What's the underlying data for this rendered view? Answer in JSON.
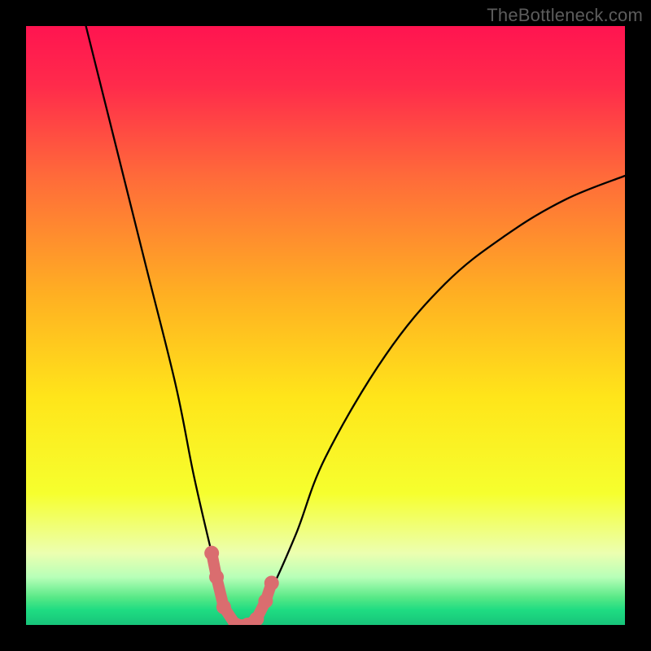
{
  "watermark": "TheBottleneck.com",
  "chart_data": {
    "type": "line",
    "title": "",
    "xlabel": "",
    "ylabel": "",
    "x_range": [
      0,
      100
    ],
    "y_range": [
      0,
      100
    ],
    "series": [
      {
        "name": "bottleneck-curve",
        "x": [
          10,
          15,
          20,
          25,
          28,
          31,
          33,
          35,
          37,
          40,
          45,
          50,
          60,
          70,
          80,
          90,
          100
        ],
        "y": [
          100,
          80,
          60,
          40,
          25,
          12,
          4,
          0,
          0,
          4,
          15,
          28,
          45,
          57,
          65,
          71,
          75
        ]
      }
    ],
    "markers": {
      "name": "highlight-cluster",
      "color": "#da6d6f",
      "points": [
        {
          "x": 31.0,
          "y": 12
        },
        {
          "x": 31.8,
          "y": 8
        },
        {
          "x": 33.0,
          "y": 3
        },
        {
          "x": 35.0,
          "y": 0
        },
        {
          "x": 37.0,
          "y": 0
        },
        {
          "x": 38.5,
          "y": 1
        },
        {
          "x": 40.0,
          "y": 4
        },
        {
          "x": 41.0,
          "y": 7
        }
      ]
    },
    "gradient_stops": [
      {
        "pos": 0.0,
        "color": "#ff1450"
      },
      {
        "pos": 0.1,
        "color": "#ff2b4b"
      },
      {
        "pos": 0.25,
        "color": "#ff6a3a"
      },
      {
        "pos": 0.45,
        "color": "#ffb022"
      },
      {
        "pos": 0.62,
        "color": "#ffe51a"
      },
      {
        "pos": 0.78,
        "color": "#f6ff2e"
      },
      {
        "pos": 0.88,
        "color": "#ecffb0"
      },
      {
        "pos": 0.92,
        "color": "#b8ffb8"
      },
      {
        "pos": 0.955,
        "color": "#55e886"
      },
      {
        "pos": 0.975,
        "color": "#1fdc82"
      },
      {
        "pos": 1.0,
        "color": "#17c47a"
      }
    ]
  }
}
